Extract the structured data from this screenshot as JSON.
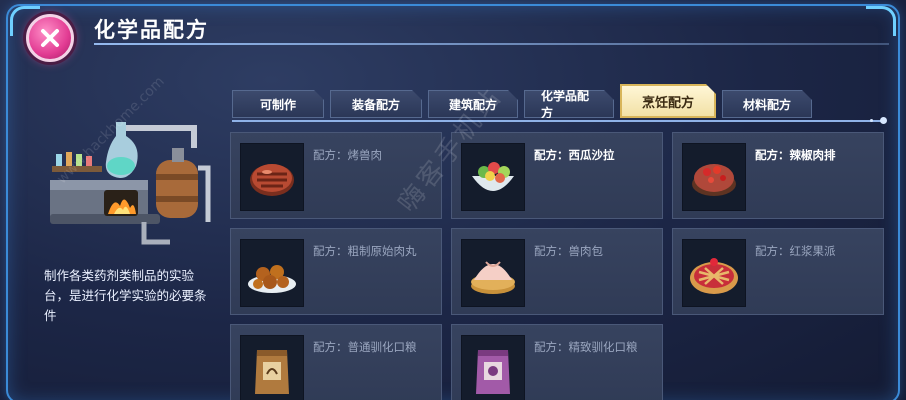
{
  "header": {
    "title": "化学品配方"
  },
  "station": {
    "description": "制作各类药剂类制品的实验台，是进行化学实验的必要条件"
  },
  "tabs": [
    {
      "label": "可制作",
      "active": false
    },
    {
      "label": "装备配方",
      "active": false
    },
    {
      "label": "建筑配方",
      "active": false
    },
    {
      "label": "化学品配方",
      "active": false
    },
    {
      "label": "烹饪配方",
      "active": true
    },
    {
      "label": "材料配方",
      "active": false
    }
  ],
  "recipes": [
    {
      "label": "配方：烤兽肉",
      "icon": "roast-meat-icon",
      "highlight": false
    },
    {
      "label": "配方：西瓜沙拉",
      "icon": "watermelon-salad-icon",
      "highlight": true
    },
    {
      "label": "配方：辣椒肉排",
      "icon": "chili-steak-icon",
      "highlight": true
    },
    {
      "label": "配方：粗制原始肉丸",
      "icon": "meatball-icon",
      "highlight": false
    },
    {
      "label": "配方：兽肉包",
      "icon": "meat-bun-icon",
      "highlight": false
    },
    {
      "label": "配方：红浆果派",
      "icon": "berry-pie-icon",
      "highlight": false
    },
    {
      "label": "配方：普通驯化口粮",
      "icon": "common-ration-icon",
      "highlight": false
    },
    {
      "label": "配方：精致驯化口粮",
      "icon": "fine-ration-icon",
      "highlight": false
    }
  ],
  "watermarks": {
    "main": "嗨客手机站",
    "url": "www.hackhome.com"
  },
  "colors": {
    "frame": "#3b8bd8",
    "close_button": "#e23c93",
    "active_tab": "#f2e1a6",
    "card_bg": "#37435f"
  }
}
